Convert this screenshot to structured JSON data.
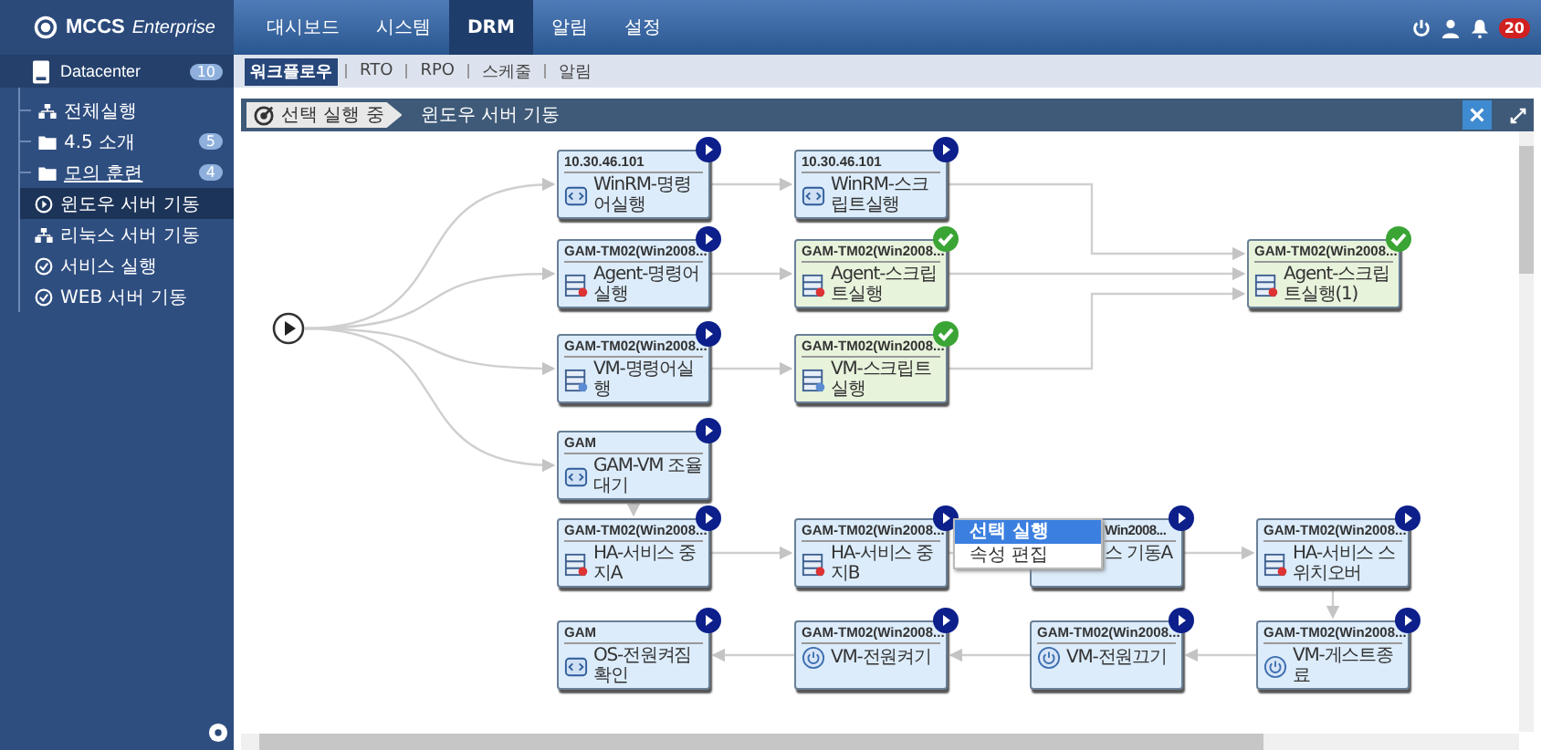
{
  "header": {
    "logo": "MCCS",
    "logo_suffix": "Enterprise",
    "nav": [
      {
        "label": "대시보드",
        "selected": false
      },
      {
        "label": "시스템",
        "selected": false
      },
      {
        "label": "DRM",
        "selected": true
      },
      {
        "label": "알림",
        "selected": false
      },
      {
        "label": "설정",
        "selected": false
      }
    ],
    "notification_count": "20"
  },
  "sidebar": {
    "root": {
      "label": "Datacenter",
      "count": "10",
      "children": [
        {
          "label": "전체실행",
          "kind": "group",
          "selected": false
        },
        {
          "label": "4.5 소개",
          "kind": "folder",
          "count": "5",
          "selected": false
        },
        {
          "label": "모의 훈련",
          "kind": "folder",
          "count": "4",
          "selected": false,
          "children": [
            {
              "label": "윈도우 서버 기동",
              "kind": "play",
              "selected": true
            },
            {
              "label": "리눅스 서버 기동",
              "kind": "group",
              "selected": false
            },
            {
              "label": "서비스 실행",
              "kind": "check",
              "selected": false
            },
            {
              "label": "WEB 서버 기동",
              "kind": "check",
              "selected": false
            }
          ]
        }
      ]
    }
  },
  "subtabs": [
    {
      "label": "워크플로우",
      "selected": true
    },
    {
      "label": "RTO",
      "selected": false
    },
    {
      "label": "RPO",
      "selected": false
    },
    {
      "label": "스케줄",
      "selected": false
    },
    {
      "label": "알림",
      "selected": false
    }
  ],
  "breadcrumb": {
    "status": "선택 실행 중",
    "title": "윈도우 서버 기동"
  },
  "nodes": [
    {
      "title": "10.30.46.101",
      "label": "WinRM-명령어실행",
      "kind": "script",
      "completed": false
    },
    {
      "title": "10.30.46.101",
      "label": "WinRM-스크립트실행",
      "kind": "script",
      "completed": false
    },
    {
      "title": "GAM-TM02(Win2008...",
      "label": "Agent-명령어실행",
      "kind": "agent",
      "completed": false
    },
    {
      "title": "GAM-TM02(Win2008...",
      "label": "Agent-스크립트실행",
      "kind": "agent",
      "completed": true
    },
    {
      "title": "GAM-TM02(Win2008...",
      "label": "VM-명령어실행",
      "kind": "vm",
      "completed": false
    },
    {
      "title": "GAM-TM02(Win2008...",
      "label": "VM-스크립트실행",
      "kind": "vm",
      "completed": true
    },
    {
      "title": "GAM-TM02(Win2008...",
      "label": "Agent-스크립트실행(1)",
      "kind": "agent",
      "completed": true
    },
    {
      "title": "GAM",
      "label": "GAM-VM 조율대기",
      "kind": "script",
      "completed": false
    },
    {
      "title": "GAM-TM02(Win2008...",
      "label": "HA-서비스 중지A",
      "kind": "agent",
      "completed": false
    },
    {
      "title": "GAM-TM02(Win2008...",
      "label": "HA-서비스 중지B",
      "kind": "agent",
      "completed": false
    },
    {
      "title": "Win2008...",
      "label": "스 기동A",
      "kind": "hidden",
      "completed": false
    },
    {
      "title": "GAM-TM02(Win2008...",
      "label": "HA-서비스 스위치오버",
      "kind": "agent",
      "completed": false
    },
    {
      "title": "GAM",
      "label": "OS-전원켜짐확인",
      "kind": "script",
      "completed": false
    },
    {
      "title": "GAM-TM02(Win2008...",
      "label": "VM-전원켜기",
      "kind": "power",
      "completed": false
    },
    {
      "title": "GAM-TM02(Win2008...",
      "label": "VM-전원끄기",
      "kind": "power",
      "completed": false
    },
    {
      "title": "GAM-TM02(Win2008...",
      "label": "VM-게스트종료",
      "kind": "power",
      "completed": false
    }
  ],
  "context_menu": [
    {
      "label": "선택 실행",
      "selected": true
    },
    {
      "label": "속성 편집",
      "selected": false
    }
  ]
}
